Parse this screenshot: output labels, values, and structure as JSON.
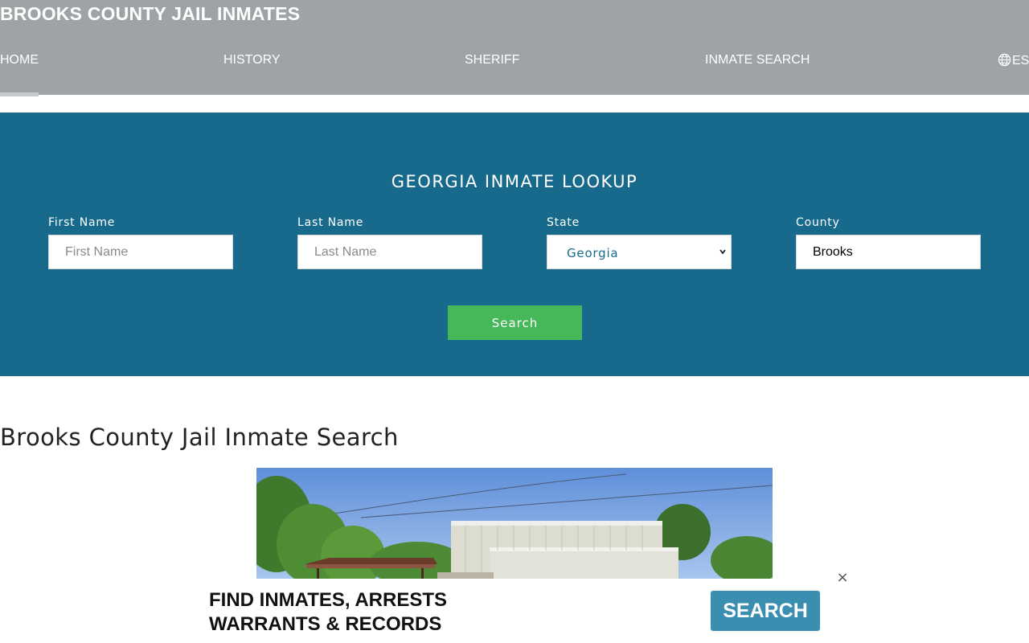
{
  "header": {
    "site_title": "BROOKS COUNTY JAIL INMATES",
    "nav": [
      {
        "label": "HOME",
        "active": true
      },
      {
        "label": "HISTORY"
      },
      {
        "label": "SHERIFF"
      },
      {
        "label": "INMATE SEARCH"
      }
    ],
    "language": {
      "icon": "globe-icon",
      "label": "ES"
    }
  },
  "lookup": {
    "title": "GEORGIA INMATE LOOKUP",
    "first_name": {
      "label": "First Name",
      "placeholder": "First Name",
      "value": ""
    },
    "last_name": {
      "label": "Last Name",
      "placeholder": "Last Name",
      "value": ""
    },
    "state": {
      "label": "State",
      "selected": "Georgia"
    },
    "county": {
      "label": "County",
      "value": "Brooks"
    },
    "search_label": "Search"
  },
  "content": {
    "heading": "Brooks County Jail Inmate Search"
  },
  "ad": {
    "line1": "FIND INMATES, ARRESTS",
    "line2": "WARRANTS & RECORDS",
    "button_label": "SEARCH",
    "close_glyph": "×"
  },
  "colors": {
    "header_bg": "#9ea3a6",
    "band_bg": "#186a8d",
    "search_button": "#46b85a",
    "ad_button": "#3a8fb1"
  }
}
